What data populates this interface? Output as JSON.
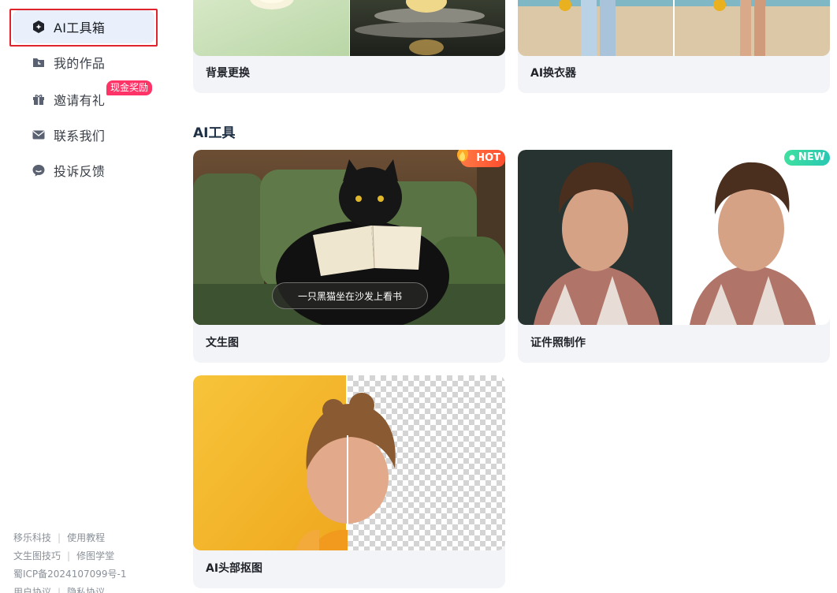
{
  "sidebar": {
    "items": [
      {
        "label": "AI工具箱",
        "icon": "ai-toolbox-icon",
        "active": true
      },
      {
        "label": "我的作品",
        "icon": "folder-icon",
        "active": false
      },
      {
        "label": "邀请有礼",
        "icon": "gift-icon",
        "active": false,
        "badge": "现金奖励"
      },
      {
        "label": "联系我们",
        "icon": "mail-icon",
        "active": false
      },
      {
        "label": "投诉反馈",
        "icon": "feedback-icon",
        "active": false
      }
    ],
    "footer": {
      "row1": [
        "移乐科技",
        "使用教程"
      ],
      "row2": [
        "文生图技巧",
        "修图学堂"
      ],
      "icp": "蜀ICP备2024107099号-1",
      "row4": [
        "用户协议",
        "隐私协议"
      ]
    }
  },
  "main": {
    "top_cards": [
      {
        "label": "背景更换"
      },
      {
        "label": "AI换衣器"
      }
    ],
    "section_title": "AI工具",
    "tool_cards": [
      {
        "label": "文生图",
        "tag": "HOT",
        "prompt": "一只黑猫坐在沙发上看书"
      },
      {
        "label": "证件照制作",
        "tag": "NEW"
      },
      {
        "label": "AI头部抠图"
      }
    ]
  },
  "colors": {
    "accent_red_border": "#e0242e",
    "active_bg": "#e9f0fb",
    "badge_pink": "#ff3366",
    "hot_orange": "#ff4d2e",
    "new_green": "#3fe0a0"
  }
}
